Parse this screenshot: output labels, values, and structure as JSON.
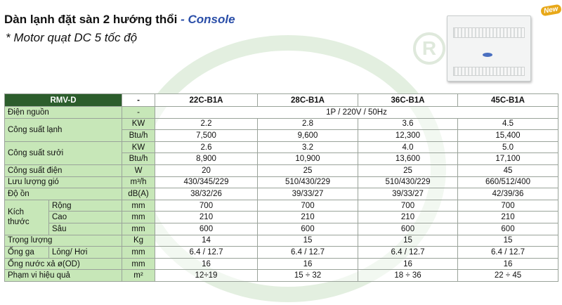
{
  "header": {
    "title_main": "Dàn lạnh đặt sàn 2 hướng thổi",
    "title_dash": " - ",
    "title_model": "Console",
    "subtitle": "* Motor quạt DC 5 tốc độ",
    "badge": "New"
  },
  "watermark": {
    "reg_mark": "R"
  },
  "colors": {
    "header_bg": "#2c5d2c",
    "label_bg": "#c7e7b8",
    "accent": "#2a4ea8"
  },
  "table": {
    "header": {
      "label": "RMV-D",
      "unit": "-",
      "models": [
        "22C-B1A",
        "28C-B1A",
        "36C-B1A",
        "45C-B1A"
      ]
    },
    "power_source": {
      "label": "Điện nguồn",
      "unit": "-",
      "value": "1P / 220V / 50Hz"
    },
    "cooling": {
      "label": "Công suất lạnh",
      "rows": [
        {
          "unit": "KW",
          "values": [
            "2.2",
            "2.8",
            "3.6",
            "4.5"
          ]
        },
        {
          "unit": "Btu/h",
          "values": [
            "7,500",
            "9,600",
            "12,300",
            "15,400"
          ]
        }
      ]
    },
    "heating": {
      "label": "Công suất sưởi",
      "rows": [
        {
          "unit": "KW",
          "values": [
            "2.6",
            "3.2",
            "4.0",
            "5.0"
          ]
        },
        {
          "unit": "Btu/h",
          "values": [
            "8,900",
            "10,900",
            "13,600",
            "17,100"
          ]
        }
      ]
    },
    "power": {
      "label": "Công suất điện",
      "unit": "W",
      "values": [
        "20",
        "25",
        "25",
        "45"
      ]
    },
    "airflow": {
      "label": "Lưu lượng gió",
      "unit": "m³/h",
      "values": [
        "430/345/229",
        "510/430/229",
        "510/430/229",
        "660/512/400"
      ]
    },
    "noise": {
      "label": "Độ ồn",
      "unit": "dB(A)",
      "values": [
        "38/32/26",
        "39/33/27",
        "39/33/27",
        "42/39/36"
      ]
    },
    "dimensions": {
      "label": "Kích thước",
      "rows": [
        {
          "sub": "Rộng",
          "unit": "mm",
          "values": [
            "700",
            "700",
            "700",
            "700"
          ]
        },
        {
          "sub": "Cao",
          "unit": "mm",
          "values": [
            "210",
            "210",
            "210",
            "210"
          ]
        },
        {
          "sub": "Sâu",
          "unit": "mm",
          "values": [
            "600",
            "600",
            "600",
            "600"
          ]
        }
      ]
    },
    "weight": {
      "label": "Trọng lượng",
      "unit": "Kg",
      "values": [
        "14",
        "15",
        "15",
        "15"
      ]
    },
    "gas_pipe": {
      "label": "Ống ga",
      "sub": "Lỏng/ Hơi",
      "unit": "mm",
      "values": [
        "6.4 / 12.7",
        "6.4 / 12.7",
        "6.4 / 12.7",
        "6.4 / 12.7"
      ]
    },
    "drain_pipe": {
      "label": "Ống nước xả ø(OD)",
      "unit": "mm",
      "values": [
        "16",
        "16",
        "16",
        "16"
      ]
    },
    "coverage": {
      "label": "Phạm vi hiệu quả",
      "unit": "m²",
      "values": [
        "12÷19",
        "15 ÷ 32",
        "18 ÷ 36",
        "22 ÷ 45"
      ]
    }
  }
}
